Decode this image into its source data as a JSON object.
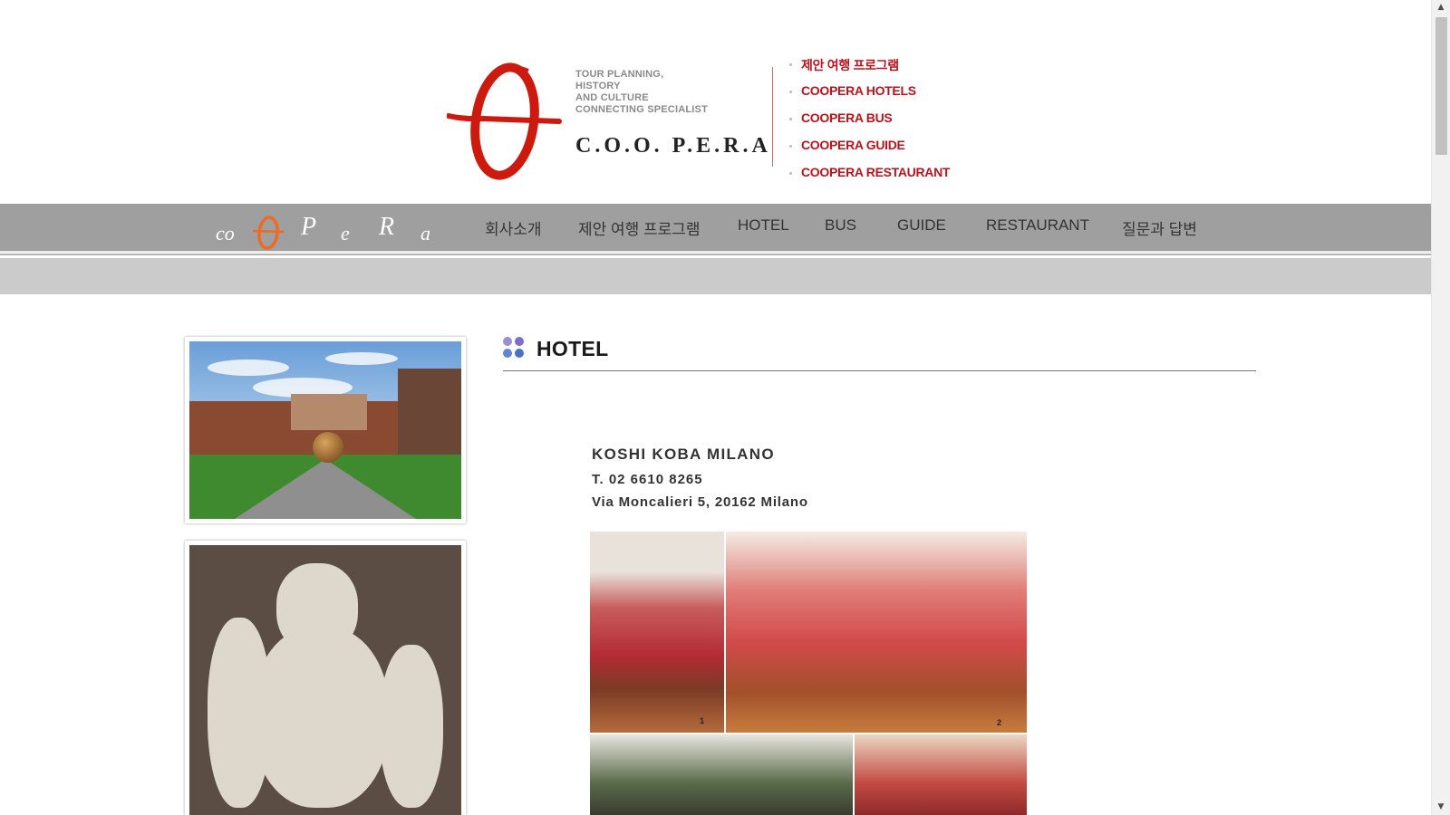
{
  "header": {
    "tagline": [
      "TOUR PLANNING,",
      "HISTORY",
      "AND CULTURE",
      "CONNECTING SPECIALIST"
    ],
    "brand": "C.O.O. P.E.R.A",
    "quick_links": [
      "제안 여행 프로그램",
      "COOPERA HOTELS",
      "COOPERA BUS",
      "COOPERA GUIDE",
      "COOPERA RESTAURANT"
    ]
  },
  "nav": {
    "logo_letters": [
      "co",
      "O",
      "P",
      "e",
      "R",
      "a"
    ],
    "items": [
      "회사소개",
      "제안 여행 프로그램",
      "HOTEL",
      "BUS",
      "GUIDE",
      "RESTAURANT",
      "질문과 답변"
    ]
  },
  "section": {
    "title": "HOTEL",
    "icon_colors": [
      "#9b8ed6",
      "#7a6ec9",
      "#5f84d4",
      "#4b6fc8"
    ]
  },
  "hotel": {
    "name": "KOSHI KOBA MILANO",
    "phone": "T. 02 6610 8265",
    "address": "Via Moncalieri 5, 20162 Milano",
    "photo_numbers": [
      "1",
      "2"
    ]
  },
  "colors": {
    "accent_red": "#b8141f",
    "logo_red": "#cc1a0e",
    "logo_orange": "#ee6a25",
    "nav_bg": "#9f9f9f"
  }
}
